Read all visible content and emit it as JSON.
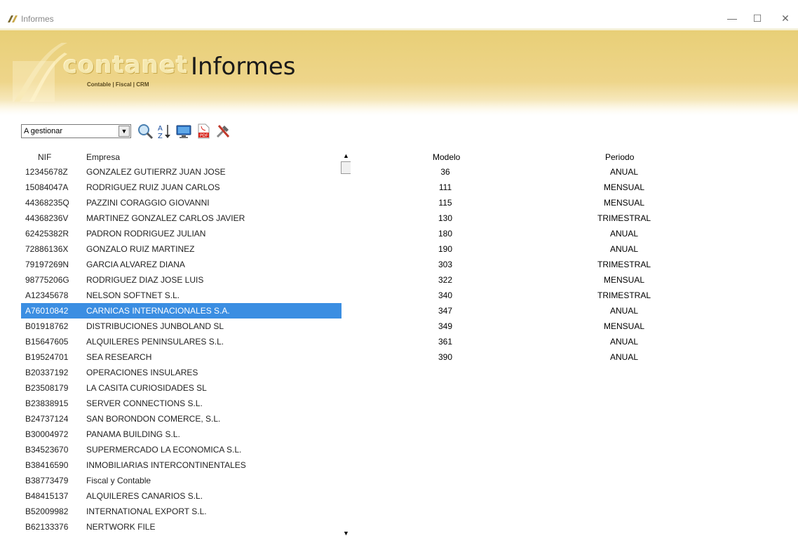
{
  "window": {
    "app_icon": "contanet-app-icon",
    "title": "Informes",
    "controls": [
      "—",
      "☐",
      "✕"
    ]
  },
  "banner": {
    "logo_word": "contanet",
    "logo_sub": "Contable | Fiscal | CRM",
    "title": "Informes",
    "accent": "#e8cf77"
  },
  "toolbar": {
    "filter_value": "A gestionar",
    "icons": [
      "search-icon",
      "sort-az-icon",
      "monitor-icon",
      "pdf-icon",
      "tools-icon"
    ]
  },
  "companies": {
    "headers": {
      "nif": "NIF",
      "empresa": "Empresa"
    },
    "selected_index": 9,
    "selected_color": "#3b8ee2",
    "rows": [
      {
        "nif": "12345678Z",
        "empresa": "GONZALEZ GUTIERRZ JUAN JOSE"
      },
      {
        "nif": "15084047A",
        "empresa": "RODRIGUEZ RUIZ JUAN CARLOS"
      },
      {
        "nif": "44368235Q",
        "empresa": "PAZZINI CORAGGIO GIOVANNI"
      },
      {
        "nif": "44368236V",
        "empresa": "MARTINEZ GONZALEZ CARLOS JAVIER"
      },
      {
        "nif": "62425382R",
        "empresa": "PADRON RODRIGUEZ JULIAN"
      },
      {
        "nif": "72886136X",
        "empresa": "GONZALO RUIZ MARTINEZ"
      },
      {
        "nif": "79197269N",
        "empresa": "GARCIA ALVAREZ DIANA"
      },
      {
        "nif": "98775206G",
        "empresa": "RODRIGUEZ DIAZ JOSE LUIS"
      },
      {
        "nif": "A12345678",
        "empresa": "NELSON SOFTNET S.L."
      },
      {
        "nif": "A76010842",
        "empresa": "CARNICAS INTERNACIONALES S.A."
      },
      {
        "nif": "B01918762",
        "empresa": "DISTRIBUCIONES JUNBOLAND SL"
      },
      {
        "nif": "B15647605",
        "empresa": "ALQUILERES PENINSULARES S.L."
      },
      {
        "nif": "B19524701",
        "empresa": "SEA RESEARCH"
      },
      {
        "nif": "B20337192",
        "empresa": "OPERACIONES INSULARES"
      },
      {
        "nif": "B23508179",
        "empresa": "LA CASITA CURIOSIDADES SL"
      },
      {
        "nif": "B23838915",
        "empresa": "SERVER CONNECTIONS S.L."
      },
      {
        "nif": "B24737124",
        "empresa": "SAN BORONDON COMERCE, S.L."
      },
      {
        "nif": "B30004972",
        "empresa": "PANAMA BUILDING S.L."
      },
      {
        "nif": "B34523670",
        "empresa": "SUPERMERCADO LA ECONOMICA S.L."
      },
      {
        "nif": "B38416590",
        "empresa": "INMOBILIARIAS INTERCONTINENTALES"
      },
      {
        "nif": "B38773479",
        "empresa": "Fiscal y Contable"
      },
      {
        "nif": "B48415137",
        "empresa": "ALQUILERES CANARIOS S.L."
      },
      {
        "nif": "B52009982",
        "empresa": "INTERNATIONAL EXPORT S.L."
      },
      {
        "nif": "B62133376",
        "empresa": "NERTWORK FILE"
      }
    ]
  },
  "models": {
    "headers": {
      "modelo": "Modelo",
      "periodo": "Periodo"
    },
    "rows": [
      {
        "modelo": "36",
        "periodo": "ANUAL"
      },
      {
        "modelo": "111",
        "periodo": "MENSUAL"
      },
      {
        "modelo": "115",
        "periodo": "MENSUAL"
      },
      {
        "modelo": "130",
        "periodo": "TRIMESTRAL"
      },
      {
        "modelo": "180",
        "periodo": "ANUAL"
      },
      {
        "modelo": "190",
        "periodo": "ANUAL"
      },
      {
        "modelo": "303",
        "periodo": "TRIMESTRAL"
      },
      {
        "modelo": "322",
        "periodo": "MENSUAL"
      },
      {
        "modelo": "340",
        "periodo": "TRIMESTRAL"
      },
      {
        "modelo": "347",
        "periodo": "ANUAL"
      },
      {
        "modelo": "349",
        "periodo": "MENSUAL"
      },
      {
        "modelo": "361",
        "periodo": "ANUAL"
      },
      {
        "modelo": "390",
        "periodo": "ANUAL"
      }
    ]
  }
}
